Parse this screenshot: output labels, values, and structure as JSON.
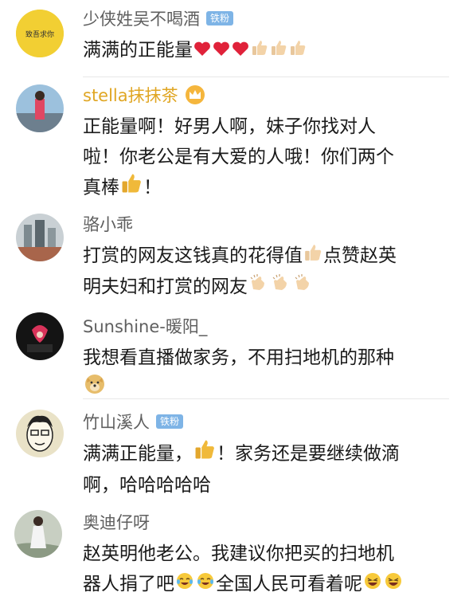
{
  "comments": [
    {
      "username": "少侠姓吴不喝酒",
      "badge": "铁粉",
      "avatar_text": "致吾求你",
      "lines": [
        "满满的正能量",
        ""
      ]
    },
    {
      "username": "stella抹抹茶",
      "lines": [
        "正能量啊！好男人啊，妹子你找对人",
        "啦！你老公是有大爱的人哦！你们两个",
        "真棒",
        "！"
      ]
    },
    {
      "username": "骆小乖",
      "lines": [
        "打赏的网友这钱真的花得值",
        "点赞赵英",
        "明夫妇和打赏的网友"
      ]
    },
    {
      "username": "Sunshine-暖阳_",
      "lines": [
        "我想看直播做家务，不用扫地机的那种"
      ]
    },
    {
      "username": "竹山溪人",
      "badge": "铁粉",
      "lines": [
        "满满正能量，",
        "！家务还是要继续做滴",
        "啊，哈哈哈哈哈"
      ]
    },
    {
      "username": "奥迪仔呀",
      "lines": [
        "赵英明他老公。我建议你把买的扫地机",
        "器人捐了吧",
        "全国人民可看着呢"
      ]
    }
  ],
  "colors": {
    "username": "#5f5f5f",
    "vip_username": "#e0a623",
    "badge_bg": "#7eb4e6",
    "heart": "#e0223a",
    "thumb": "#f0b93a"
  }
}
